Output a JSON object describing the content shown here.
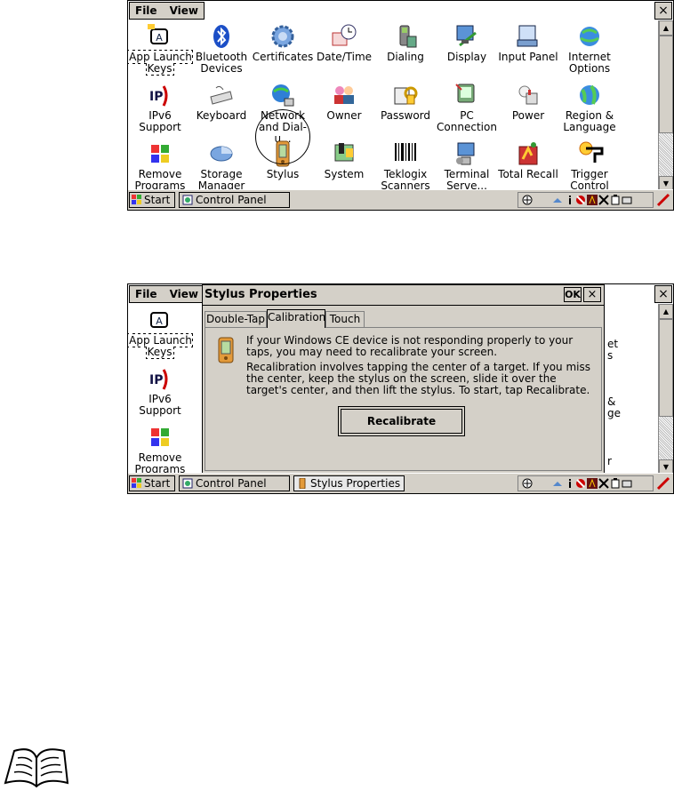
{
  "screen1": {
    "menu": {
      "file": "File",
      "view": "View"
    },
    "close": "×",
    "icons": [
      {
        "label": "App Launch\nKeys",
        "icon": "app-launch-keys-icon"
      },
      {
        "label": "Bluetooth\nDevices",
        "icon": "bluetooth-icon"
      },
      {
        "label": "Certificates",
        "icon": "certificates-icon"
      },
      {
        "label": "Date/Time",
        "icon": "date-time-icon"
      },
      {
        "label": "Dialing",
        "icon": "dialing-icon"
      },
      {
        "label": "Display",
        "icon": "display-icon"
      },
      {
        "label": "Input Panel",
        "icon": "input-panel-icon"
      },
      {
        "label": "Internet\nOptions",
        "icon": "internet-options-icon"
      },
      {
        "label": "IPv6\nSupport",
        "icon": "ipv6-icon"
      },
      {
        "label": "Keyboard",
        "icon": "keyboard-icon"
      },
      {
        "label": "Network\nand Dial-u...",
        "icon": "network-icon"
      },
      {
        "label": "Owner",
        "icon": "owner-icon"
      },
      {
        "label": "Password",
        "icon": "password-icon"
      },
      {
        "label": "PC\nConnection",
        "icon": "pc-connection-icon"
      },
      {
        "label": "Power",
        "icon": "power-icon"
      },
      {
        "label": "Region &\nLanguage",
        "icon": "region-icon"
      },
      {
        "label": "Remove\nPrograms",
        "icon": "remove-programs-icon"
      },
      {
        "label": "Storage\nManager",
        "icon": "storage-manager-icon"
      },
      {
        "label": "Stylus",
        "icon": "stylus-icon"
      },
      {
        "label": "System",
        "icon": "system-icon"
      },
      {
        "label": "Teklogix\nScanners",
        "icon": "scanners-icon"
      },
      {
        "label": "Terminal\nServe...",
        "icon": "terminal-server-icon"
      },
      {
        "label": "Total Recall",
        "icon": "total-recall-icon"
      },
      {
        "label": "Trigger\nControl",
        "icon": "trigger-control-icon"
      }
    ],
    "taskbar": {
      "start": "Start",
      "task1": "Control Panel"
    }
  },
  "screen2": {
    "menu": {
      "file": "File",
      "view": "View"
    },
    "close": "×",
    "left_icons": [
      {
        "label": "App Launch\nKeys"
      },
      {
        "label": "IPv6\nSupport"
      },
      {
        "label": "Remove\nPrograms"
      }
    ],
    "right_fragments": [
      "et",
      "s",
      "&",
      "ge",
      "r"
    ],
    "dialog": {
      "title": "Stylus Properties",
      "ok": "OK",
      "close": "×",
      "tabs": [
        "Double-Tap",
        "Calibration",
        "Touch"
      ],
      "active_tab": "Calibration",
      "para1": "If your Windows CE device is not responding properly to your taps, you may need to recalibrate your screen.",
      "para2": "Recalibration involves tapping the center of a target. If you miss the center, keep the stylus on the screen, slide it over the target's center, and then lift the stylus. To start, tap Recalibrate.",
      "button": "Recalibrate"
    },
    "taskbar": {
      "start": "Start",
      "task1": "Control Panel",
      "task2": "Stylus Properties"
    }
  },
  "colors": {
    "chrome": "#d4d0c8",
    "border": "#000000"
  }
}
